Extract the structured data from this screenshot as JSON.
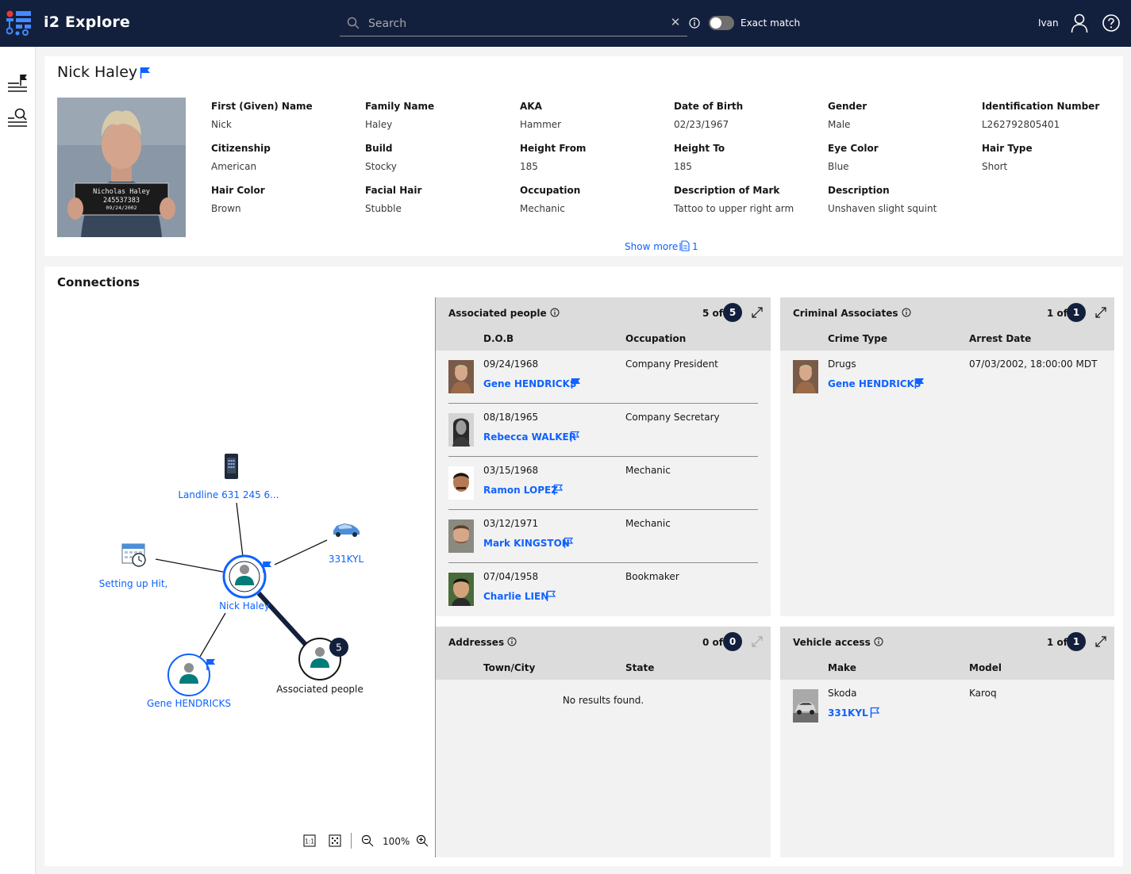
{
  "app": {
    "title": "i2 Explore",
    "logo_icon": "i2-logo-icon"
  },
  "search": {
    "placeholder": "Search",
    "value": "",
    "exact_match_label": "Exact match",
    "exact_match_on": false
  },
  "user": {
    "name": "Ivan"
  },
  "colors": {
    "header_bg": "#13203d",
    "link": "#0f62fe",
    "panel_bg": "#f2f2f2",
    "panel_head": "#dcdcdc",
    "node_teal": "#007d79"
  },
  "rail": {
    "items": [
      {
        "name": "watchlist-icon"
      },
      {
        "name": "search-list-icon"
      }
    ]
  },
  "profile": {
    "name": "Nick Haley",
    "photo_caption": {
      "line1": "Nicholas Haley",
      "line2": "245537383",
      "line3": "09/24/2002"
    },
    "fields": [
      {
        "label": "First (Given) Name",
        "value": "Nick"
      },
      {
        "label": "Family Name",
        "value": "Haley"
      },
      {
        "label": "AKA",
        "value": "Hammer"
      },
      {
        "label": "Date of Birth",
        "value": "02/23/1967"
      },
      {
        "label": "Gender",
        "value": "Male"
      },
      {
        "label": "Identification Number",
        "value": "L262792805401"
      },
      {
        "label": "Citizenship",
        "value": "American"
      },
      {
        "label": "Build",
        "value": "Stocky"
      },
      {
        "label": "Height From",
        "value": "185"
      },
      {
        "label": "Height To",
        "value": "185"
      },
      {
        "label": "Eye Color",
        "value": "Blue"
      },
      {
        "label": "Hair Type",
        "value": "Short"
      },
      {
        "label": "Hair Color",
        "value": "Brown"
      },
      {
        "label": "Facial Hair",
        "value": "Stubble"
      },
      {
        "label": "Occupation",
        "value": "Mechanic"
      },
      {
        "label": "Description of Mark",
        "value": "Tattoo to upper right arm"
      },
      {
        "label": "Description",
        "value": "Unshaven slight squint"
      }
    ],
    "show_more": "Show more",
    "document_count": "1"
  },
  "connections": {
    "title": "Connections",
    "graph": {
      "nodes": {
        "landline": "Landline 631 245 6...",
        "vehicle": "331KYL",
        "event": "Setting up Hit,",
        "center": "Nick Haley",
        "associate": "Gene HENDRICKS",
        "group": "Associated people",
        "group_count": "5"
      },
      "zoom": "100%"
    },
    "panels": {
      "associated_people": {
        "title": "Associated people",
        "count_text": "5 of",
        "total": "5",
        "columns": [
          "D.O.B",
          "Occupation"
        ],
        "rows": [
          {
            "dob": "09/24/1968",
            "occupation": "Company President",
            "name": "Gene HENDRICKS",
            "flag_filled": true
          },
          {
            "dob": "08/18/1965",
            "occupation": "Company Secretary",
            "name": "Rebecca WALKER",
            "flag_filled": false
          },
          {
            "dob": "03/15/1968",
            "occupation": "Mechanic",
            "name": "Ramon LOPEZ",
            "flag_filled": false
          },
          {
            "dob": "03/12/1971",
            "occupation": "Mechanic",
            "name": "Mark KINGSTON",
            "flag_filled": false
          },
          {
            "dob": "07/04/1958",
            "occupation": "Bookmaker",
            "name": "Charlie LIEN",
            "flag_filled": false
          }
        ]
      },
      "criminal_associates": {
        "title": "Criminal Associates",
        "count_text": "1 of",
        "total": "1",
        "columns": [
          "Crime Type",
          "Arrest Date"
        ],
        "rows": [
          {
            "crime_type": "Drugs",
            "arrest_date": "07/03/2002, 18:00:00 MDT",
            "name": "Gene HENDRICKS",
            "flag_filled": true
          }
        ]
      },
      "addresses": {
        "title": "Addresses",
        "count_text": "0 of",
        "total": "0",
        "columns": [
          "Town/City",
          "State"
        ],
        "empty_text": "No results found."
      },
      "vehicle_access": {
        "title": "Vehicle access",
        "count_text": "1 of",
        "total": "1",
        "columns": [
          "Make",
          "Model"
        ],
        "rows": [
          {
            "make": "Skoda",
            "model": "Karoq",
            "name": "331KYL",
            "flag_filled": false
          }
        ]
      }
    }
  }
}
